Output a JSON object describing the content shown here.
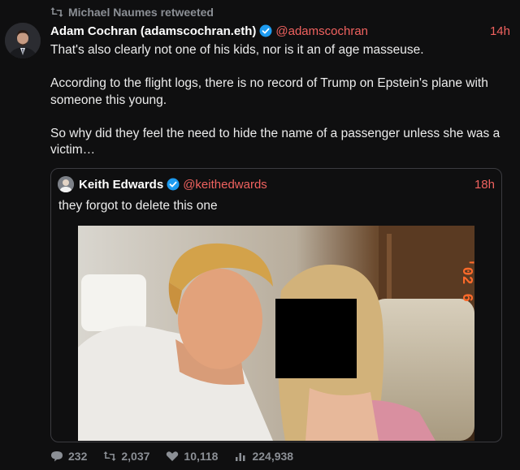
{
  "retweet": {
    "text": "Michael Naumes retweeted"
  },
  "tweet": {
    "name": "Adam Cochran (adamscochran.eth)",
    "handle": "@adamscochran",
    "time": "14h",
    "paragraphs": [
      "That's also clearly not one of his kids, nor is it an of age masseuse.",
      "According to the flight logs, there is no record of Trump on Epstein's plane with someone this young.",
      "So why did they feel the need to hide the name of a passenger unless she was a victim…"
    ]
  },
  "quote": {
    "name": "Keith Edwards",
    "handle": "@keithedwards",
    "time": "18h",
    "text": "they forgot to delete this one",
    "photo_overlay_text": "'02 6"
  },
  "stats": {
    "replies": "232",
    "retweets": "2,037",
    "likes": "10,118",
    "views": "224,938"
  },
  "colors": {
    "background": "#0f0f10",
    "accent": "#f0625f",
    "muted": "#8b8f95",
    "verified": "#1d9bf0"
  }
}
